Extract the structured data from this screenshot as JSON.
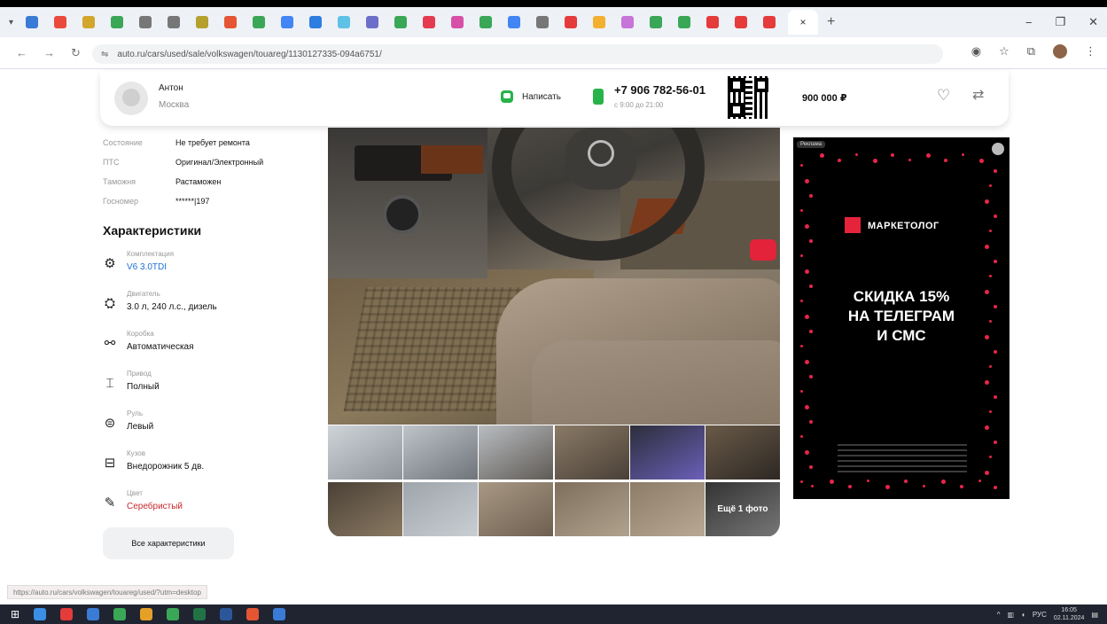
{
  "browser": {
    "tabs_icons": [
      "#3a7bd5",
      "#e94a3b",
      "#d2a52c",
      "#3aa757",
      "#777777",
      "#777777",
      "#b5a02e",
      "#e55533",
      "#3aa757",
      "#4285f4",
      "#2e7de1",
      "#5ec2e6",
      "#6c6fc9",
      "#3aa757",
      "#e53b50",
      "#d84fa8",
      "#3aa757",
      "#4285f4",
      "#777777",
      "#e53b3b",
      "#f2b02e",
      "#c774d8",
      "#3aa757",
      "#3aa757",
      "#e53b3b",
      "#e53b3b",
      "#e53b3b"
    ],
    "active_tab_close": "×",
    "new_tab": "+",
    "window_buttons": [
      "−",
      "❐",
      "✕"
    ],
    "url": "auto.ru/cars/used/sale/volkswagen/touareg/1130127335-094a6751/"
  },
  "seller": {
    "name": "Антон",
    "city": "Москва",
    "write_label": "Написать",
    "phone": "+7 906 782-56-01",
    "phone_hours": "с 9:00 до 21:00",
    "price": "900 000 ₽"
  },
  "props": [
    {
      "label": "Состояние",
      "value": "Не требует ремонта"
    },
    {
      "label": "ПТС",
      "value": "Оригинал/Электронный"
    },
    {
      "label": "Таможня",
      "value": "Растаможен"
    },
    {
      "label": "Госномер",
      "value": "******|197"
    }
  ],
  "specs_title": "Характеристики",
  "specs": [
    {
      "icon": "⚙",
      "icon_name": "engine-config-icon",
      "label": "Комплектация",
      "value": "V6 3.0TDI",
      "style": "link"
    },
    {
      "icon": "⛭",
      "icon_name": "engine-icon",
      "label": "Двигатель",
      "value": "3.0 л, 240 л.с., дизель",
      "style": ""
    },
    {
      "icon": "⚯",
      "icon_name": "gearbox-icon",
      "label": "Коробка",
      "value": "Автоматическая",
      "style": ""
    },
    {
      "icon": "⌶",
      "icon_name": "drive-icon",
      "label": "Привод",
      "value": "Полный",
      "style": ""
    },
    {
      "icon": "⊜",
      "icon_name": "steering-wheel-icon",
      "label": "Руль",
      "value": "Левый",
      "style": ""
    },
    {
      "icon": "⊟",
      "icon_name": "body-icon",
      "label": "Кузов",
      "value": "Внедорожник 5 дв.",
      "style": ""
    },
    {
      "icon": "✎",
      "icon_name": "color-icon",
      "label": "Цвет",
      "value": "Серебристый",
      "style": "red"
    }
  ],
  "all_specs_button": "Все характеристики",
  "gallery": {
    "more_label": "Ещё 1 фото",
    "thumb_colors": [
      [
        "#cfd4d8",
        "#8d949a"
      ],
      [
        "#bfc4c9",
        "#6e7479"
      ],
      [
        "#b9bdc1",
        "#5f5a55"
      ],
      [
        "#8a7a66",
        "#4a4038"
      ],
      [
        "#2b2e3a",
        "#6b5fb8"
      ],
      [
        "#6a5a48",
        "#2d2824"
      ],
      [
        "#4a4036",
        "#8a7a62"
      ],
      [
        "#9ea5ab",
        "#c9ced2"
      ],
      [
        "#a89884",
        "#6e6050"
      ],
      [
        "#7e6f5c",
        "#b1a28e"
      ],
      [
        "#8c7c68",
        "#b8a894"
      ],
      [
        "#333333",
        "#777777"
      ]
    ]
  },
  "ad": {
    "tag": "Реклама",
    "brand": "МАРКЕТОЛОГ",
    "headline": [
      "СКИДКА 15%",
      "НА ТЕЛЕГРАМ",
      "И СМС"
    ]
  },
  "status_url": "https://auto.ru/cars/volkswagen/touareg/used/?utm=desktop",
  "taskbar": {
    "icons": [
      "#3a8ee6",
      "#e53b3b",
      "#3a7bd5",
      "#3aa757",
      "#e5a028",
      "#3aa757",
      "#217346",
      "#2b579a",
      "#e55533",
      "#3a7bd5"
    ],
    "tray_lang": "РУС",
    "time": "16:05",
    "date": "02.11.2024"
  }
}
